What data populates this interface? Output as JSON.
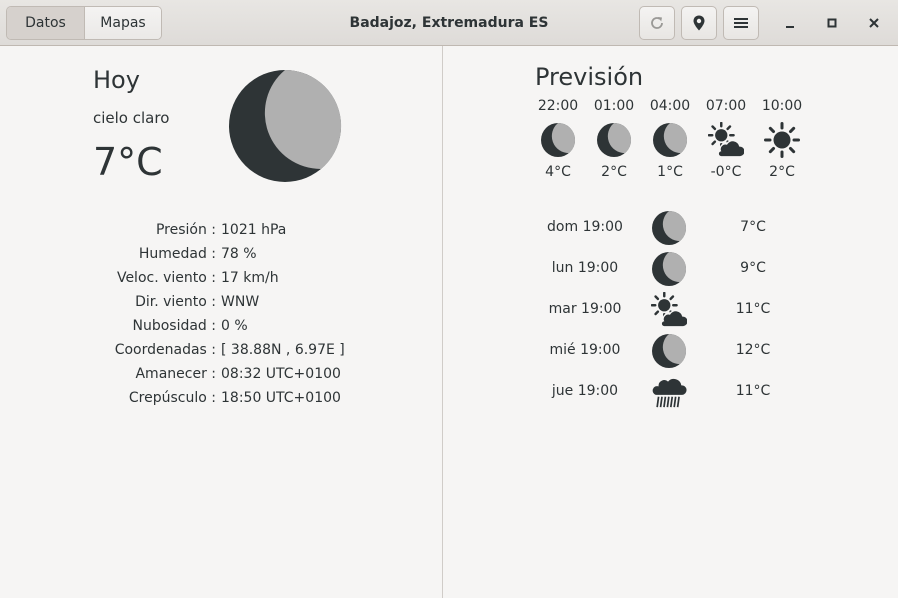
{
  "header": {
    "tabs": [
      {
        "label": "Datos",
        "active": true
      },
      {
        "label": "Mapas",
        "active": false
      }
    ],
    "title": "Badajoz, Extremadura ES",
    "icons": [
      "refresh-icon",
      "location-pin-icon",
      "menu-icon",
      "minimize-icon",
      "maximize-icon",
      "close-icon"
    ]
  },
  "today": {
    "heading": "Hoy",
    "description": "cielo claro",
    "temperature": "7°C",
    "icon": "moon-icon",
    "details": [
      {
        "label": "Presión :",
        "value": "1021 hPa"
      },
      {
        "label": "Humedad :",
        "value": "78 %"
      },
      {
        "label": "Veloc. viento :",
        "value": "17 km/h"
      },
      {
        "label": "Dir. viento :",
        "value": "WNW"
      },
      {
        "label": "Nubosidad :",
        "value": "0 %"
      },
      {
        "label": "Coordenadas :",
        "value": "[ 38.88N , 6.97E ]"
      },
      {
        "label": "Amanecer :",
        "value": "08:32 UTC+0100"
      },
      {
        "label": "Crepúsculo :",
        "value": "18:50 UTC+0100"
      }
    ]
  },
  "forecast": {
    "heading": "Previsión",
    "hourly": [
      {
        "time": "22:00",
        "icon": "moon-icon",
        "temp": "4°C"
      },
      {
        "time": "01:00",
        "icon": "moon-icon",
        "temp": "2°C"
      },
      {
        "time": "04:00",
        "icon": "moon-icon",
        "temp": "1°C"
      },
      {
        "time": "07:00",
        "icon": "sun-cloud-icon",
        "temp": "-0°C"
      },
      {
        "time": "10:00",
        "icon": "sun-icon",
        "temp": "2°C"
      }
    ],
    "daily": [
      {
        "day": "dom 19:00",
        "icon": "moon-icon",
        "temp": "7°C"
      },
      {
        "day": "lun 19:00",
        "icon": "moon-icon",
        "temp": "9°C"
      },
      {
        "day": "mar 19:00",
        "icon": "sun-cloud-icon",
        "temp": "11°C"
      },
      {
        "day": "mié 19:00",
        "icon": "moon-icon",
        "temp": "12°C"
      },
      {
        "day": "jue 19:00",
        "icon": "rain-cloud-icon",
        "temp": "11°C"
      }
    ]
  },
  "colors": {
    "icon_dark": "#2e3436",
    "icon_light": "#b0b0b0",
    "background": "#f6f5f4"
  }
}
